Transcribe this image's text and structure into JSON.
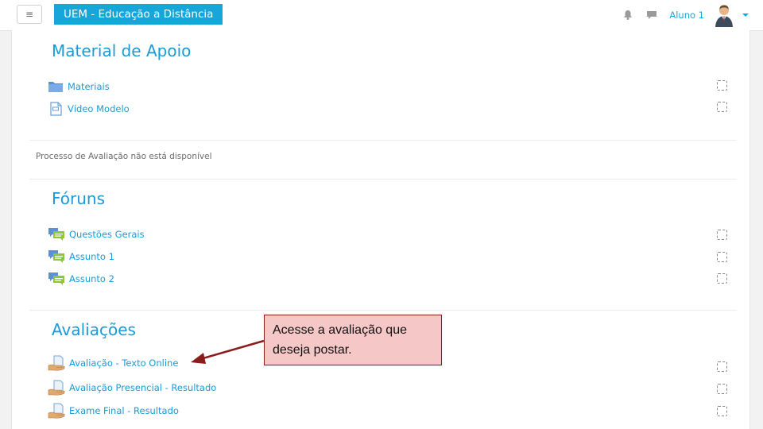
{
  "navbar": {
    "menu_icon": "hamburger-icon",
    "brand": "UEM - Educação a Distância",
    "user_name": "Aluno 1",
    "icons": [
      "notification-bell-icon",
      "chat-bubble-icon",
      "user-avatar",
      "chevron-down-icon"
    ]
  },
  "sections": [
    {
      "title": "Material de Apoio",
      "activities": [
        {
          "label": "Materiais",
          "icon": "folder-icon"
        },
        {
          "label": "Vídeo Modelo",
          "icon": "page-icon"
        }
      ]
    },
    {
      "notice": "Processo de Avaliação não está disponível"
    },
    {
      "title": "Fóruns",
      "activities": [
        {
          "label": "Questões Gerais",
          "icon": "forum-icon"
        },
        {
          "label": "Assunto 1",
          "icon": "forum-icon"
        },
        {
          "label": "Assunto 2",
          "icon": "forum-icon"
        }
      ]
    },
    {
      "title": "Avaliações",
      "activities": [
        {
          "label": "Avaliação - Texto Online",
          "icon": "assignment-icon"
        },
        {
          "label": "Avaliação Presencial - Resultado",
          "icon": "assignment-icon"
        },
        {
          "label": "Exame Final - Resultado",
          "icon": "assignment-icon"
        }
      ]
    }
  ],
  "callout": {
    "text": "Acesse a avaliação que deseja postar."
  },
  "colors": {
    "brand": "#16a6d9",
    "link": "#1a9ad6",
    "callout_bg": "#f5c7c7",
    "callout_border": "#8a1c1c"
  }
}
